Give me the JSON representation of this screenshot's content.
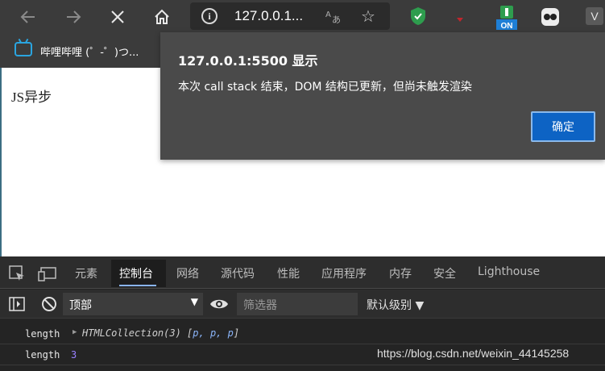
{
  "browser": {
    "url": "127.0.0.1...",
    "tab_title": "哔哩哔哩 (゜-゜)つ...",
    "ext_on_label": "ON",
    "avatar_letter": "V"
  },
  "page": {
    "text": "JS异步"
  },
  "dialog": {
    "title": "127.0.0.1:5500 显示",
    "message": "本次 call stack 结束，DOM 结构已更新，但尚未触发渲染",
    "ok_label": "确定"
  },
  "devtools": {
    "tabs": [
      "元素",
      "控制台",
      "网络",
      "源代码",
      "性能",
      "应用程序",
      "内存",
      "安全",
      "Lighthouse"
    ],
    "active_tab": "控制台",
    "context": "顶部",
    "filter_placeholder": "筛选器",
    "levels": "默认级别 ▼",
    "console": [
      {
        "key": "length",
        "obj_prefix": "HTMLCollection(3) [",
        "items": "p, p, p",
        "obj_suffix": "]"
      },
      {
        "key": "length",
        "value": "3"
      }
    ]
  },
  "watermark": "https://blog.csdn.net/weixin_44145258",
  "colors": {
    "chrome_bg": "#3b3b3b",
    "dialog_bg": "#4a4a4a",
    "primary_button": "#0d63c4",
    "devtools_bg": "#242424"
  }
}
